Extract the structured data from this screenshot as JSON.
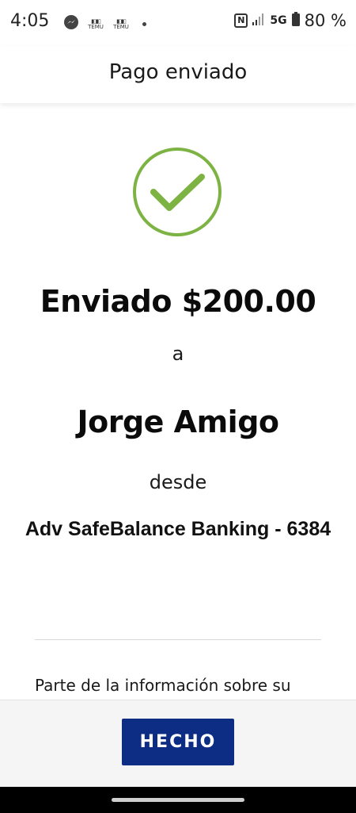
{
  "status_bar": {
    "time": "4:05",
    "notification_icons": [
      "messenger-icon",
      "temu-icon",
      "temu-icon"
    ],
    "temu_label": "TEMU",
    "network": "5G",
    "battery": "80 %"
  },
  "header": {
    "title": "Pago enviado"
  },
  "confirmation": {
    "status_icon": "checkmark-circle-icon",
    "accent_color": "#7cb342",
    "sent_amount": "Enviado $200.00",
    "to_word": "a",
    "recipient": "Jorge Amigo",
    "from_word": "desde",
    "account": "Adv SafeBalance Banking - 6384",
    "info_text": "Parte de la información sobre su"
  },
  "footer": {
    "done_label": "HECHO",
    "button_color": "#0c2d83"
  }
}
